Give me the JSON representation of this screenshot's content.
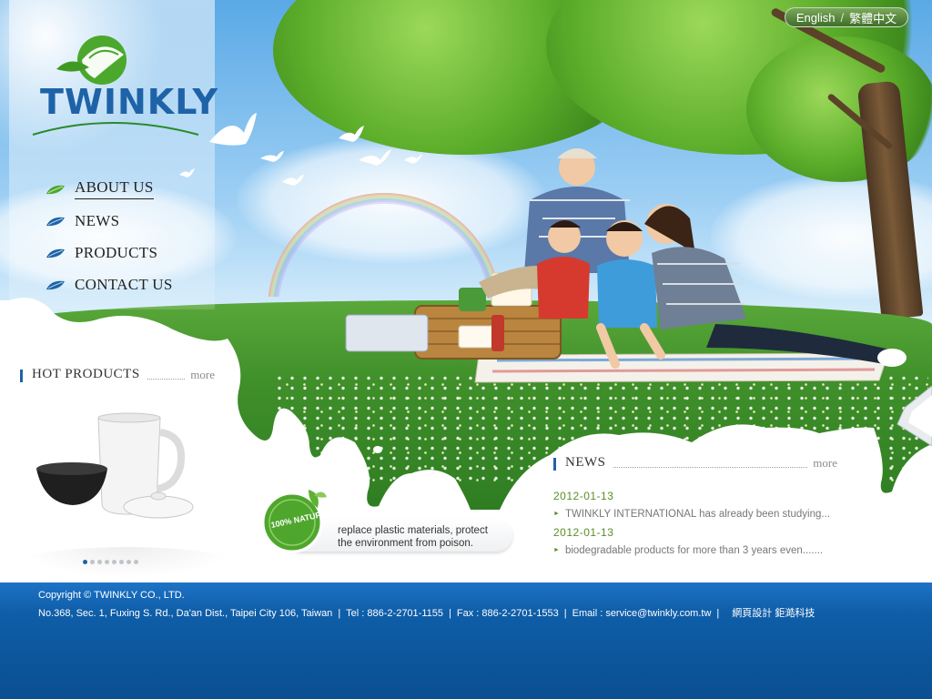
{
  "brand": {
    "logo_text": "TWINKLY",
    "color_primary": "#1e63a8",
    "color_green": "#5b8e24"
  },
  "language_switch": {
    "english": "English",
    "traditional_chinese": "繁體中文"
  },
  "nav": {
    "items": [
      {
        "label": "ABOUT US",
        "active": true
      },
      {
        "label": "NEWS",
        "active": false
      },
      {
        "label": "PRODUCTS",
        "active": false
      },
      {
        "label": "CONTACT US",
        "active": false
      }
    ]
  },
  "hot_products": {
    "title": "HOT PRODUCTS",
    "more": "more",
    "carousel_pages": 8,
    "carousel_current": 1
  },
  "eco_badge": {
    "seal_text": "100% NATURAL",
    "line1": "replace plastic materials, protect",
    "line2": "the environment from poison."
  },
  "news": {
    "title": "NEWS",
    "more": "more",
    "items": [
      {
        "date": "2012-01-13",
        "text": "TWINKLY INTERNATIONAL has already been studying..."
      },
      {
        "date": "2012-01-13",
        "text": "biodegradable products for more than 3 years even......."
      }
    ]
  },
  "footer": {
    "copyright": "Copyright © TWINKLY CO., LTD.",
    "address": "No.368, Sec. 1, Fuxing S. Rd., Da'an Dist., Taipei City 106, Taiwan",
    "tel": "Tel : 886-2-2701-1155",
    "fax": "Fax : 886-2-2701-1553",
    "email": "Email : service@twinkly.com.tw",
    "credit": "網頁設計 鉅澔科技"
  }
}
